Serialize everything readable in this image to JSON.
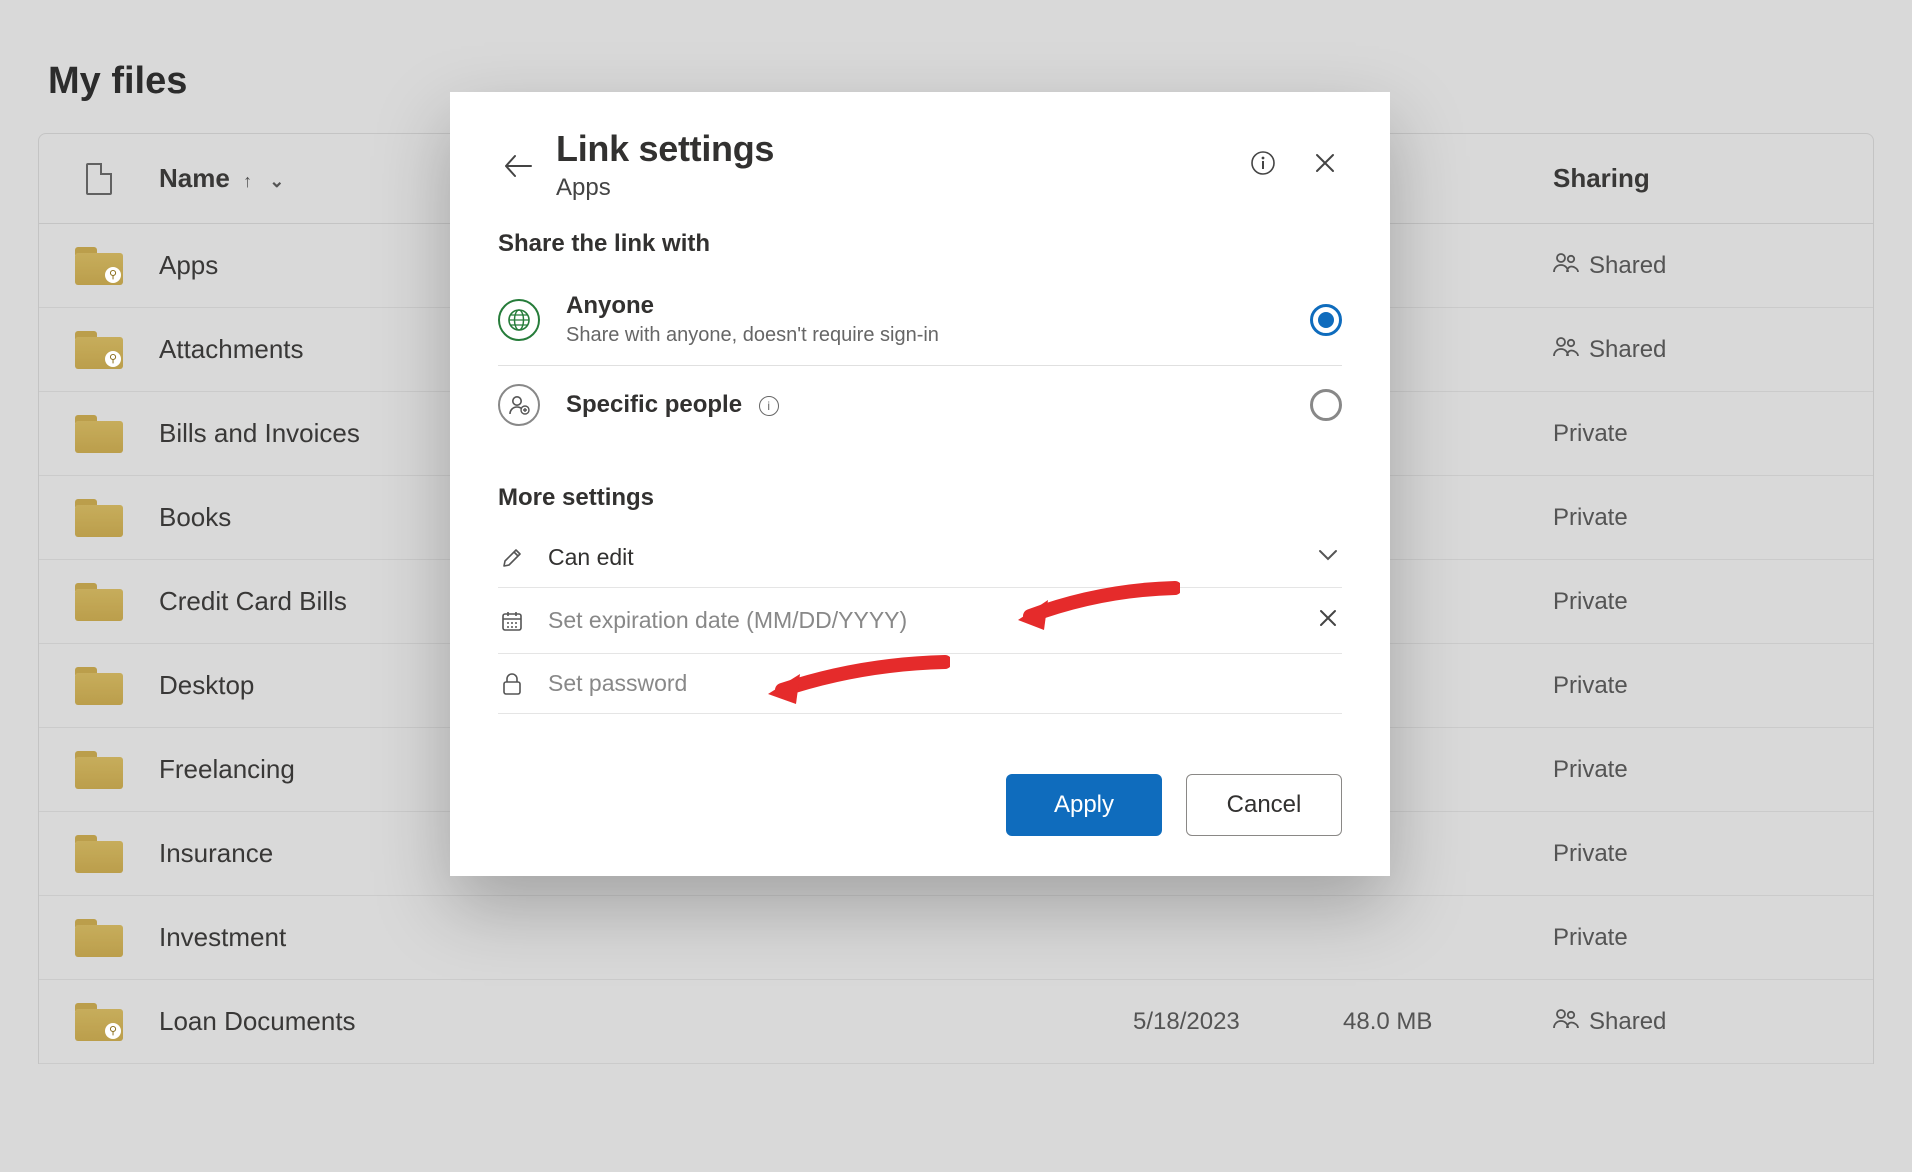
{
  "page": {
    "title": "My files"
  },
  "columns": {
    "name": "Name",
    "sharing": "Sharing"
  },
  "files": [
    {
      "name": "Apps",
      "shared": true,
      "sharing": "Shared",
      "date": "",
      "size": ""
    },
    {
      "name": "Attachments",
      "shared": true,
      "sharing": "Shared",
      "date": "",
      "size": ""
    },
    {
      "name": "Bills and Invoices",
      "shared": false,
      "sharing": "Private",
      "date": "",
      "size": ""
    },
    {
      "name": "Books",
      "shared": false,
      "sharing": "Private",
      "date": "",
      "size": ""
    },
    {
      "name": "Credit Card Bills",
      "shared": false,
      "sharing": "Private",
      "date": "",
      "size": ""
    },
    {
      "name": "Desktop",
      "shared": false,
      "sharing": "Private",
      "date": "",
      "size": ""
    },
    {
      "name": "Freelancing",
      "shared": false,
      "sharing": "Private",
      "date": "",
      "size": ""
    },
    {
      "name": "Insurance",
      "shared": false,
      "sharing": "Private",
      "date": "",
      "size": ""
    },
    {
      "name": "Investment",
      "shared": false,
      "sharing": "Private",
      "date": "",
      "size": ""
    },
    {
      "name": "Loan Documents",
      "shared": true,
      "sharing": "Shared",
      "date": "5/18/2023",
      "size": "48.0 MB"
    }
  ],
  "modal": {
    "title": "Link settings",
    "subtitle": "Apps",
    "share_label": "Share the link with",
    "options": {
      "anyone": {
        "title": "Anyone",
        "desc": "Share with anyone, doesn't require sign-in"
      },
      "specific": {
        "title": "Specific people"
      }
    },
    "selected_option": "anyone",
    "more_label": "More settings",
    "permission": {
      "label": "Can edit"
    },
    "expiration": {
      "placeholder": "Set expiration date (MM/DD/YYYY)"
    },
    "password": {
      "placeholder": "Set password"
    },
    "apply": "Apply",
    "cancel": "Cancel"
  }
}
